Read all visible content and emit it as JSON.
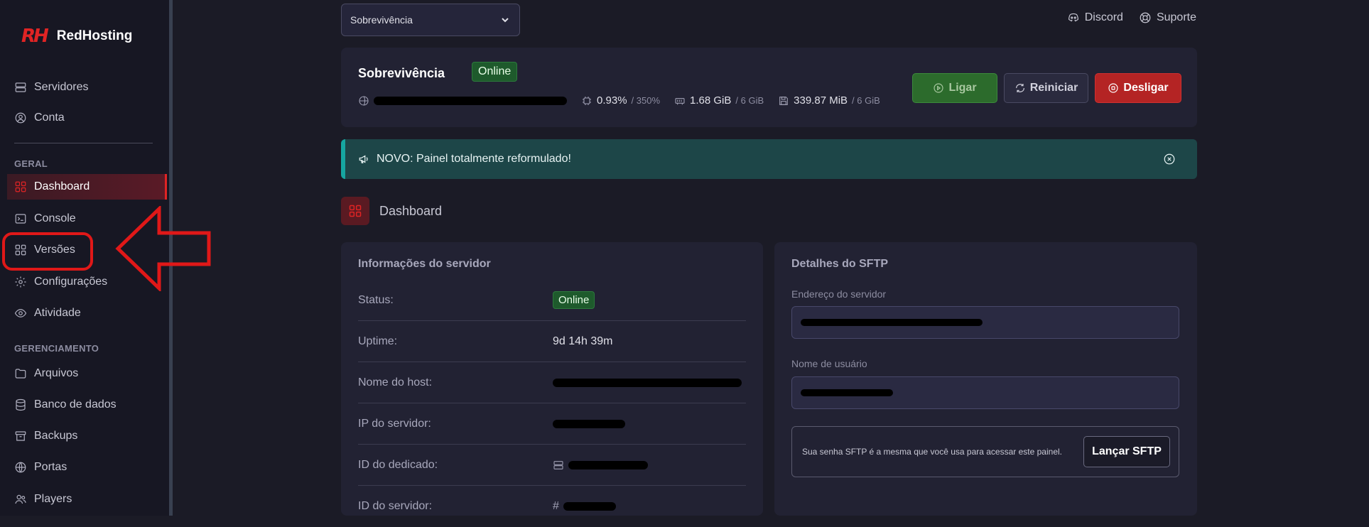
{
  "brand": {
    "mark": "RH",
    "name": "RedHosting",
    "accent": "#e02424"
  },
  "sidebar": {
    "top_items": [
      {
        "label": "Servidores",
        "icon": "server-icon"
      },
      {
        "label": "Conta",
        "icon": "user-circle-icon"
      }
    ],
    "section_geral": "GERAL",
    "geral_items": [
      {
        "label": "Dashboard",
        "icon": "grid-icon",
        "active": true
      },
      {
        "label": "Console",
        "icon": "terminal-icon"
      },
      {
        "label": "Versões",
        "icon": "grid-icon"
      },
      {
        "label": "Configurações",
        "icon": "gear-icon"
      },
      {
        "label": "Atividade",
        "icon": "eye-icon"
      }
    ],
    "section_gerenciamento": "GERENCIAMENTO",
    "gerenciamento_items": [
      {
        "label": "Arquivos",
        "icon": "folder-icon"
      },
      {
        "label": "Banco de dados",
        "icon": "database-icon"
      },
      {
        "label": "Backups",
        "icon": "archive-icon"
      },
      {
        "label": "Portas",
        "icon": "globe-icon"
      },
      {
        "label": "Players",
        "icon": "users-icon"
      }
    ]
  },
  "header": {
    "server_select": "Sobrevivência",
    "discord_label": "Discord",
    "support_label": "Suporte"
  },
  "server": {
    "name": "Sobrevivência",
    "status": "Online",
    "cpu": "0.93%",
    "cpu_max": "/ 350%",
    "ram": "1.68 GiB",
    "ram_max": "/ 6 GiB",
    "disk": "339.87 MiB",
    "disk_max": "/ 6 GiB"
  },
  "actions": {
    "start": "Ligar",
    "restart": "Reiniciar",
    "stop": "Desligar"
  },
  "notice": {
    "text": "NOVO: Painel totalmente reformulado!"
  },
  "dashboard_title": "Dashboard",
  "info_card": {
    "title": "Informações do servidor",
    "rows": [
      {
        "key": "Status:",
        "value": "Online"
      },
      {
        "key": "Uptime:",
        "value": "9d 14h 39m"
      },
      {
        "key": "Nome do host:",
        "value": ""
      },
      {
        "key": "IP do servidor:",
        "value": ""
      },
      {
        "key": "ID do dedicado:",
        "value": ""
      },
      {
        "key": "ID do servidor:",
        "value": "#"
      }
    ]
  },
  "sftp_card": {
    "title": "Detalhes do SFTP",
    "address_label": "Endereço do servidor",
    "username_label": "Nome de usuário",
    "password_note": "Sua senha SFTP é a mesma que você usa para acessar este painel.",
    "launch_button": "Lançar SFTP"
  }
}
